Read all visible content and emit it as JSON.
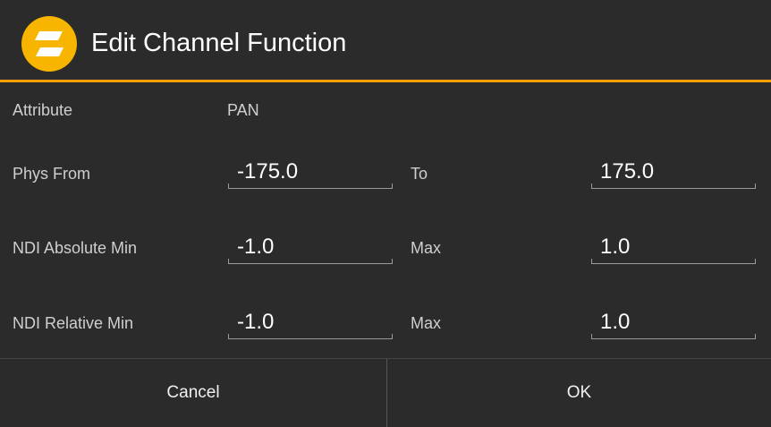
{
  "header": {
    "title": "Edit Channel Function",
    "logo_icon": "app-logo-icon",
    "accent_color": "#f5a000"
  },
  "rows": {
    "attribute": {
      "label": "Attribute",
      "value": "PAN"
    },
    "phys": {
      "label": "Phys From",
      "from_value": "-175.0",
      "to_label": "To",
      "to_value": "175.0"
    },
    "ndi_absolute": {
      "label": "NDI Absolute Min",
      "min_value": "-1.0",
      "max_label": "Max",
      "max_value": "1.0"
    },
    "ndi_relative": {
      "label": "NDI Relative Min",
      "min_value": "-1.0",
      "max_label": "Max",
      "max_value": "1.0"
    }
  },
  "footer": {
    "cancel_label": "Cancel",
    "ok_label": "OK"
  }
}
